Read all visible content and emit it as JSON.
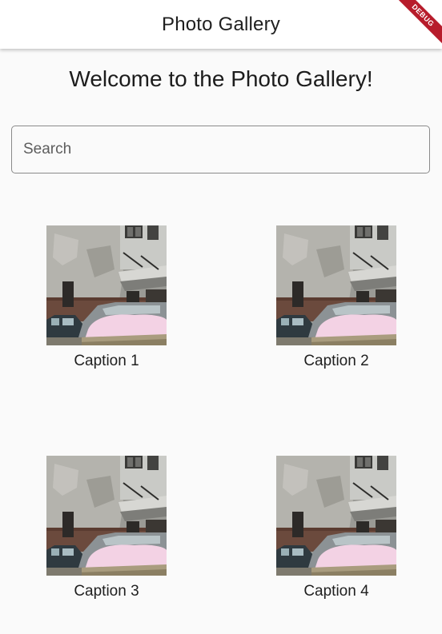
{
  "appbar": {
    "title": "Photo Gallery",
    "debug_label": "DEBUG"
  },
  "main": {
    "heading": "Welcome to the Photo Gallery!",
    "search": {
      "placeholder": "Search",
      "value": ""
    },
    "gallery": [
      {
        "caption": "Caption 1"
      },
      {
        "caption": "Caption 2"
      },
      {
        "caption": "Caption 3"
      },
      {
        "caption": "Caption 4"
      }
    ]
  },
  "colors": {
    "background": "#fafafa",
    "appbar": "#ffffff",
    "debug_banner": "#b71c2b",
    "car_snow": "#f3d2e4"
  }
}
